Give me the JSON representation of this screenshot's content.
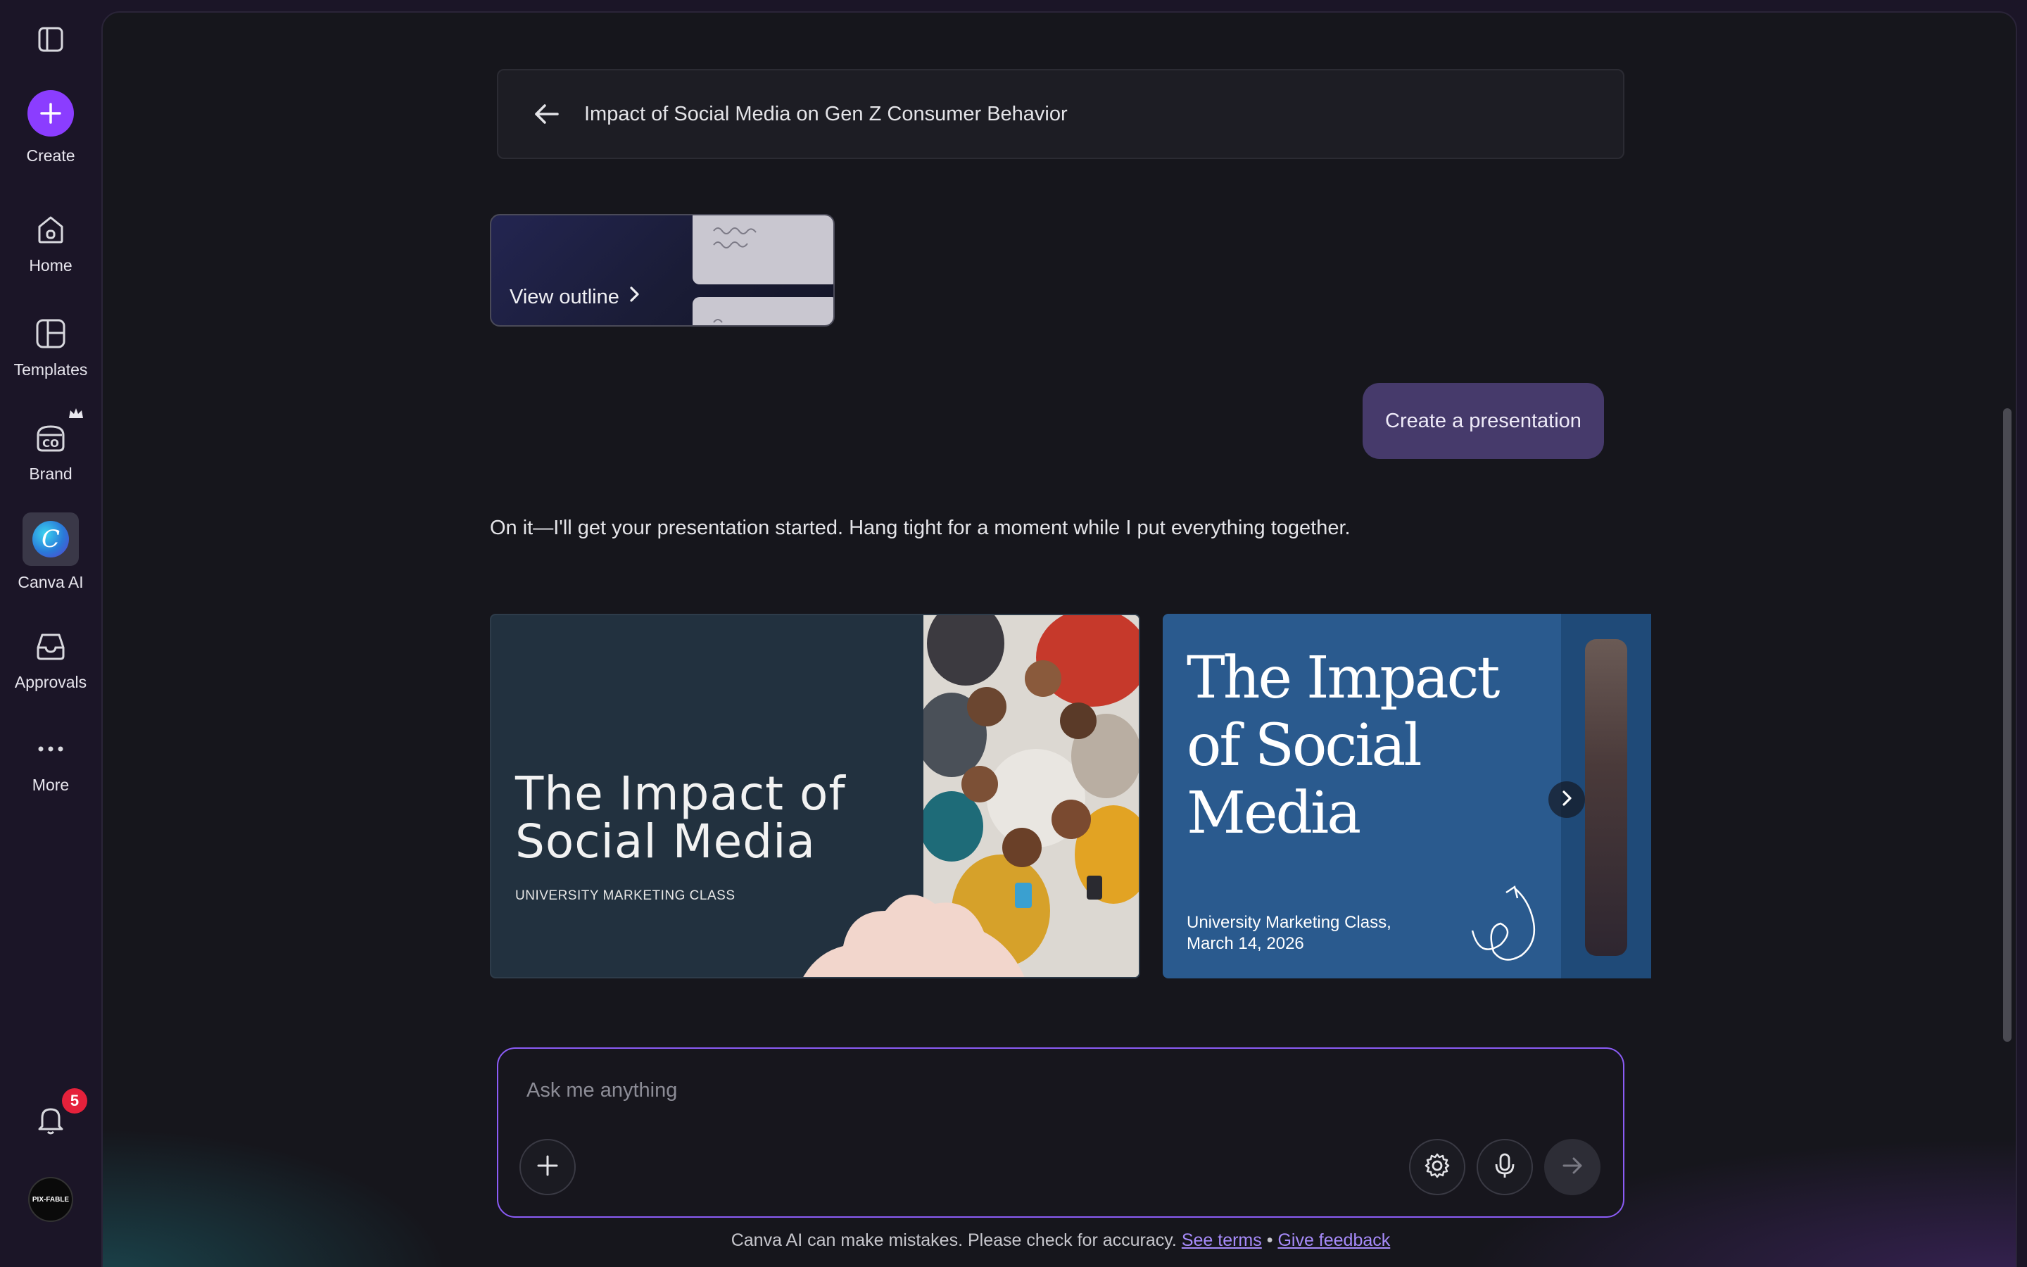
{
  "sidebar": {
    "toggle_icon": "sidebar-panel-icon",
    "items": [
      {
        "label": "Create",
        "icon": "plus-icon"
      },
      {
        "label": "Home",
        "icon": "home-icon"
      },
      {
        "label": "Templates",
        "icon": "templates-icon"
      },
      {
        "label": "Brand",
        "icon": "brand-icon"
      },
      {
        "label": "Canva AI",
        "icon": "canva-ai-icon"
      },
      {
        "label": "Approvals",
        "icon": "inbox-icon"
      },
      {
        "label": "More",
        "icon": "more-icon"
      }
    ],
    "notifications_count": "5",
    "avatar_text": "PIX-FABLE"
  },
  "header": {
    "title": "Impact of Social Media on Gen Z Consumer Behavior"
  },
  "outline_card": {
    "label": "View outline"
  },
  "user_message": "Create a presentation",
  "ai_message": "On it—I'll get your presentation started. Hang tight for a moment while I put everything together.",
  "slides": [
    {
      "title": "The Impact of Social Media",
      "subtitle": "UNIVERSITY MARKETING CLASS",
      "bg_color": "#22313f"
    },
    {
      "title": "The Impact of Social Media",
      "subtitle_line1": "University Marketing Class,",
      "subtitle_line2": "March 14, 2026",
      "bg_color": "#2a5a8e"
    }
  ],
  "composer": {
    "placeholder": "Ask me anything"
  },
  "disclaimer": {
    "text": "Canva AI can make mistakes. Please check for accuracy.",
    "terms_link": "See terms",
    "separator": "•",
    "feedback_link": "Give feedback"
  },
  "colors": {
    "accent": "#8b3dff",
    "composer_border": "#8b5cf6",
    "user_bubble": "#463a6b",
    "notification_badge": "#e5213b"
  }
}
